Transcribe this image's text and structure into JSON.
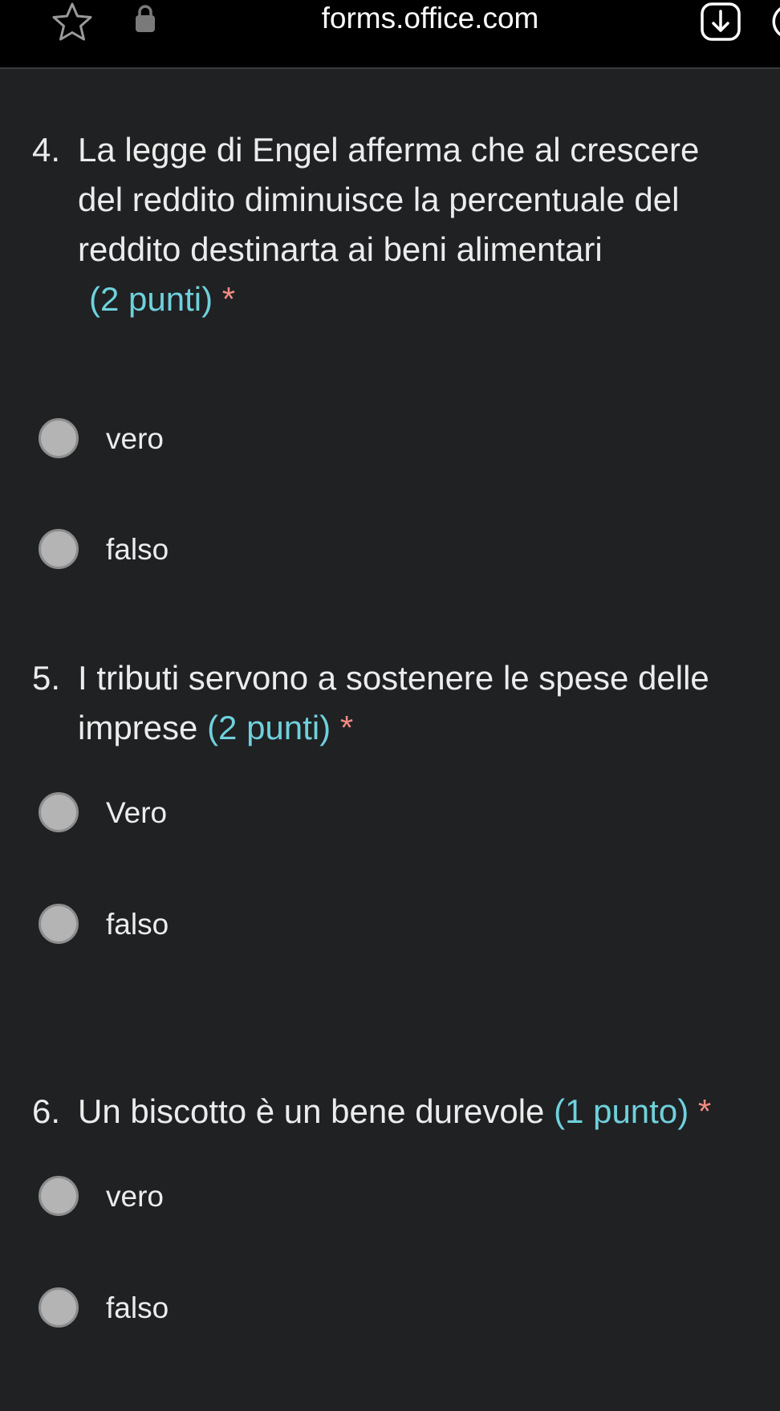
{
  "browser": {
    "url": "forms.office.com",
    "icons": [
      "star-icon",
      "lock-icon",
      "download-icon"
    ]
  },
  "colors": {
    "background": "#1f2123",
    "points": "#6fd1dc",
    "required": "#f28b82",
    "radio": "#b4b4b4"
  },
  "questions": [
    {
      "number": "4.",
      "lines": [
        "La legge di Engel afferma che al crescere",
        "del reddito diminuisce la percentuale del",
        "reddito destinarta ai beni alimentari"
      ],
      "points": "(2 punti)",
      "required_mark": "*",
      "options": [
        "vero",
        "falso"
      ]
    },
    {
      "number": "5.",
      "lines": [
        "I tributi servono a sostenere le spese delle",
        "imprese"
      ],
      "points": "(2 punti)",
      "required_mark": "*",
      "options": [
        "Vero",
        "falso"
      ]
    },
    {
      "number": "6.",
      "lines": [
        "Un biscotto è un bene durevole"
      ],
      "points": "(1 punto)",
      "required_mark": "*",
      "options": [
        "vero",
        "falso"
      ]
    }
  ]
}
